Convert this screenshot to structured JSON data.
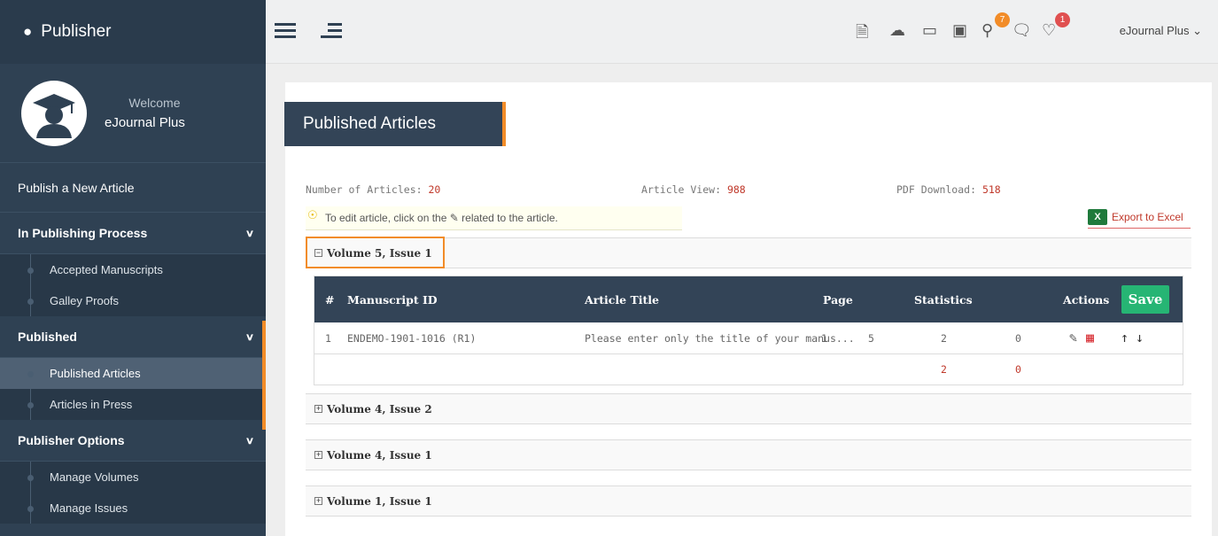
{
  "sidebar": {
    "title": "Publisher",
    "welcome": "Welcome",
    "username": "eJournal Plus",
    "publish_link": "Publish a New Article",
    "sections": [
      {
        "label": "In Publishing Process",
        "items": [
          "Accepted Manuscripts",
          "Galley Proofs"
        ]
      },
      {
        "label": "Published",
        "items": [
          "Published Articles",
          "Articles in Press"
        ]
      },
      {
        "label": "Publisher Options",
        "items": [
          "Manage Volumes",
          "Manage Issues"
        ]
      }
    ],
    "active_item": "Published Articles"
  },
  "topbar": {
    "user_menu": "eJournal Plus",
    "badges": {
      "review": "7",
      "notifications": "1"
    }
  },
  "page": {
    "title": "Published Articles",
    "stats": {
      "articles_label": "Number of Articles:",
      "articles_value": "20",
      "views_label": "Article View:",
      "views_value": "988",
      "downloads_label": "PDF Download:",
      "downloads_value": "518"
    },
    "tip_before": "To edit article, click on the",
    "tip_after": "related to the article.",
    "export_label": "Export to Excel",
    "export_icon": "X"
  },
  "volumes": [
    {
      "label": "Volume 5, Issue 1",
      "expanded": true
    },
    {
      "label": "Volume 4, Issue 2",
      "expanded": false
    },
    {
      "label": "Volume 4, Issue 1",
      "expanded": false
    },
    {
      "label": "Volume 1, Issue 1",
      "expanded": false
    }
  ],
  "table": {
    "headers": [
      "#",
      "Manuscript ID",
      "Article Title",
      "Page",
      "Statistics",
      "Actions"
    ],
    "save_label": "Save",
    "rows": [
      {
        "num": "1",
        "manuscript_id": "ENDEMO-1901-1016 (R1)",
        "title": "Please enter only the title of your manus...",
        "page_from": "1",
        "page_to": "5",
        "views": "2",
        "downloads": "0"
      }
    ],
    "totals": {
      "views": "2",
      "downloads": "0"
    }
  },
  "colors": {
    "sidebar": "#2f4153",
    "accent": "#f28c28",
    "save": "#26b574",
    "highlight": "#c0392b"
  }
}
